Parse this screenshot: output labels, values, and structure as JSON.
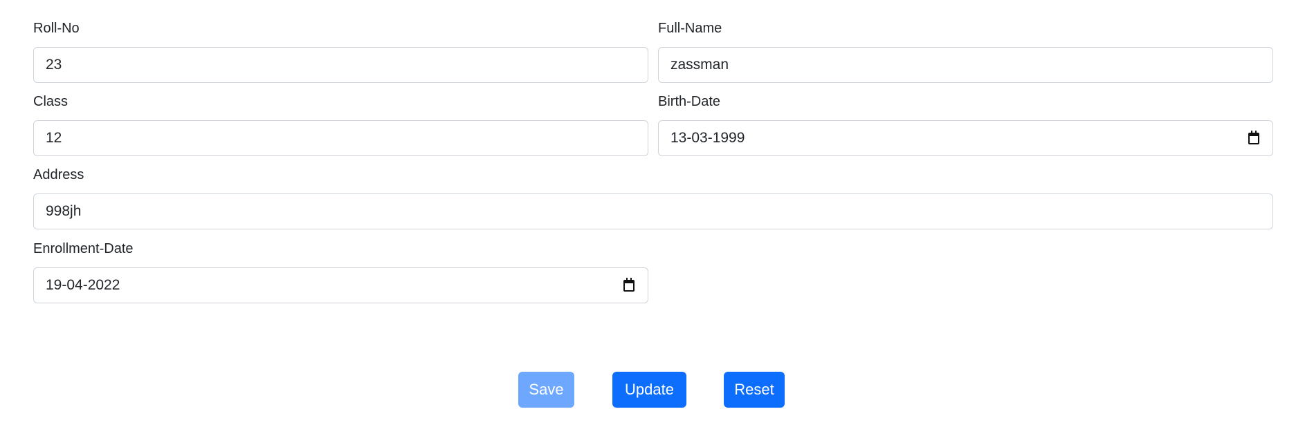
{
  "form": {
    "roll_no": {
      "label": "Roll-No",
      "value": "23"
    },
    "full_name": {
      "label": "Full-Name",
      "value": "zassman"
    },
    "class": {
      "label": "Class",
      "value": "12"
    },
    "birth_date": {
      "label": "Birth-Date",
      "value": "13-03-1999"
    },
    "address": {
      "label": "Address",
      "value": "998jh"
    },
    "enrollment_date": {
      "label": "Enrollment-Date",
      "value": "19-04-2022"
    }
  },
  "buttons": {
    "save": "Save",
    "update": "Update",
    "reset": "Reset"
  },
  "icons": {
    "date_picker": "calendar-icon"
  },
  "colors": {
    "primary": "#0d6efd",
    "primary_disabled": "#6ea8fe",
    "input_border": "#ced4da",
    "text": "#212529"
  }
}
